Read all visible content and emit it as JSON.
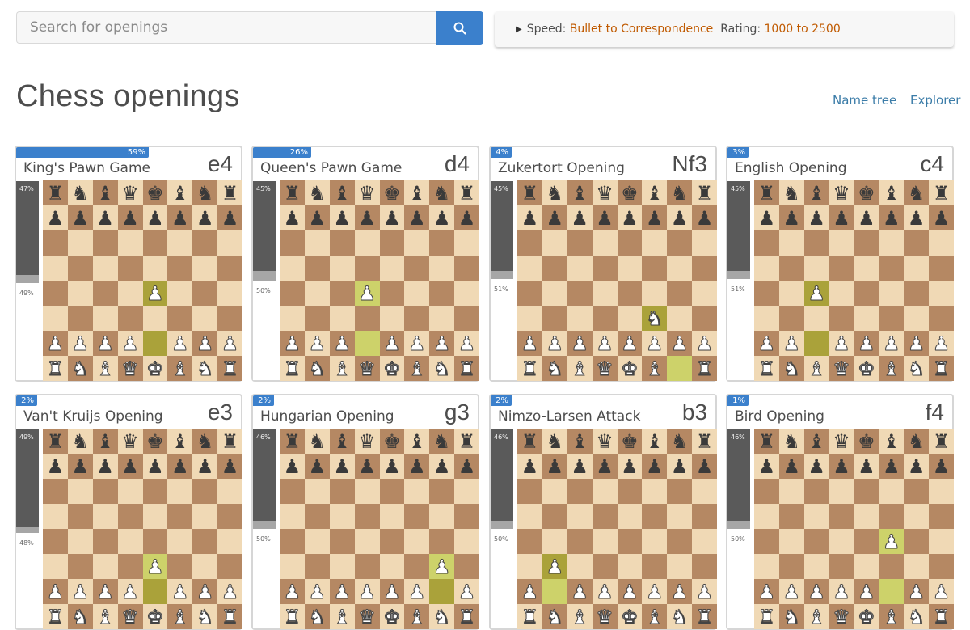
{
  "search": {
    "placeholder": "Search for openings",
    "button_icon": "search-icon"
  },
  "filters": {
    "speed_label": "Speed:",
    "speed_value": "Bullet to Correspondence",
    "rating_label": "Rating:",
    "rating_value": "1000 to 2500"
  },
  "page_title": "Chess openings",
  "links": {
    "name_tree": "Name tree",
    "explorer": "Explorer"
  },
  "colors": {
    "accent": "#3b80cc",
    "link": "#3b7ca8",
    "filter_value": "#c05a00",
    "board_light": "#f0d9b5",
    "board_dark": "#b58863",
    "highlight_light": "#cdd26a",
    "highlight_dark": "#aaa23a"
  },
  "openings": [
    {
      "name": "King's Pawn Game",
      "move": "e4",
      "pct_label": "59%",
      "pct": 59,
      "black_label": "47%",
      "white_label": "49%",
      "black": 47,
      "white": 49,
      "from": "e2",
      "to": "e4",
      "piece": "P"
    },
    {
      "name": "Queen's Pawn Game",
      "move": "d4",
      "pct_label": "26%",
      "pct": 26,
      "black_label": "45%",
      "white_label": "50%",
      "black": 45,
      "white": 50,
      "from": "d2",
      "to": "d4",
      "piece": "P"
    },
    {
      "name": "Zukertort Opening",
      "move": "Nf3",
      "pct_label": "4%",
      "pct": 4,
      "black_label": "45%",
      "white_label": "51%",
      "black": 45,
      "white": 51,
      "from": "g1",
      "to": "f3",
      "piece": "N"
    },
    {
      "name": "English Opening",
      "move": "c4",
      "pct_label": "3%",
      "pct": 3,
      "black_label": "45%",
      "white_label": "51%",
      "black": 45,
      "white": 51,
      "from": "c2",
      "to": "c4",
      "piece": "P"
    },
    {
      "name": "Van't Kruijs Opening",
      "move": "e3",
      "pct_label": "2%",
      "pct": 2,
      "black_label": "49%",
      "white_label": "48%",
      "black": 49,
      "white": 48,
      "from": "e2",
      "to": "e3",
      "piece": "P"
    },
    {
      "name": "Hungarian Opening",
      "move": "g3",
      "pct_label": "2%",
      "pct": 2,
      "black_label": "46%",
      "white_label": "50%",
      "black": 46,
      "white": 50,
      "from": "g2",
      "to": "g3",
      "piece": "P"
    },
    {
      "name": "Nimzo-Larsen Attack",
      "move": "b3",
      "pct_label": "2%",
      "pct": 2,
      "black_label": "46%",
      "white_label": "50%",
      "black": 46,
      "white": 50,
      "from": "b2",
      "to": "b3",
      "piece": "P"
    },
    {
      "name": "Bird Opening",
      "move": "f4",
      "pct_label": "1%",
      "pct": 1,
      "black_label": "46%",
      "white_label": "50%",
      "black": 46,
      "white": 50,
      "from": "f2",
      "to": "f4",
      "piece": "P"
    }
  ]
}
